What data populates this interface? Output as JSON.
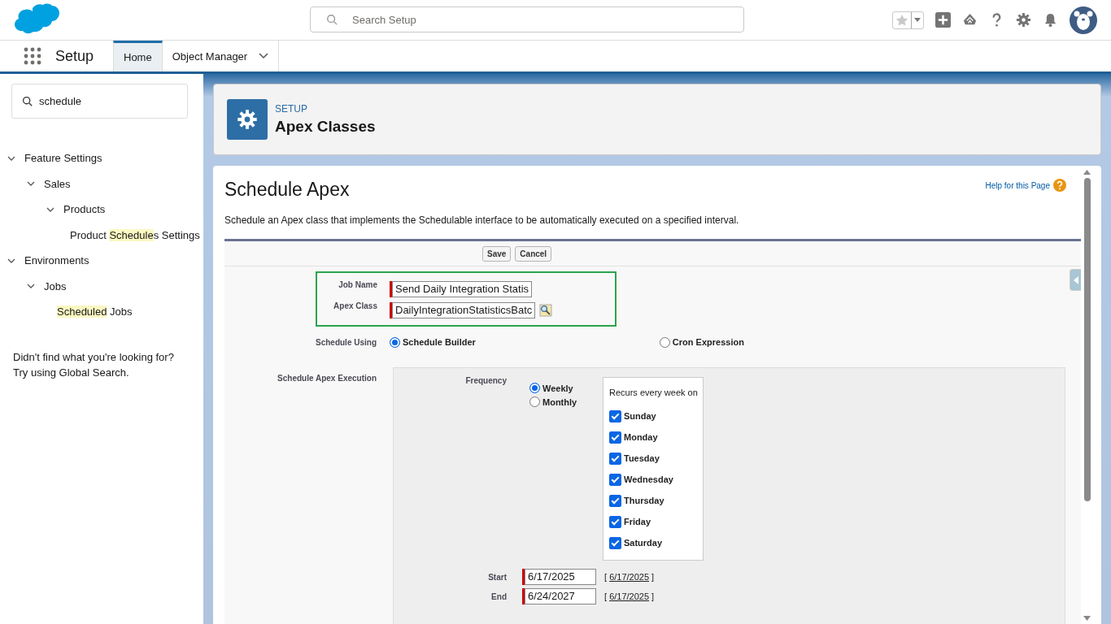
{
  "header": {
    "search": {
      "placeholder": "Search Setup"
    }
  },
  "nav": {
    "app_name": "Setup",
    "tabs": [
      {
        "label": "Home",
        "selected": true,
        "dropdown": false
      },
      {
        "label": "Object Manager",
        "selected": false,
        "dropdown": true
      }
    ]
  },
  "sidebar": {
    "search": {
      "value": "schedule"
    },
    "tree": [
      {
        "parts": [
          {
            "text": "Feature Settings",
            "highlighted": false
          }
        ],
        "expanded": true,
        "children": [
          {
            "parts": [
              {
                "text": "Sales",
                "highlighted": false
              }
            ],
            "expanded": true,
            "children": [
              {
                "parts": [
                  {
                    "text": "Products",
                    "highlighted": false
                  }
                ],
                "expanded": true,
                "children": [
                  {
                    "parts": [
                      {
                        "text": "Product ",
                        "highlighted": false
                      },
                      {
                        "text": "Schedule",
                        "highlighted": true
                      },
                      {
                        "text": "s Settings",
                        "highlighted": false
                      }
                    ]
                  }
                ]
              }
            ]
          }
        ]
      },
      {
        "parts": [
          {
            "text": "Environments",
            "highlighted": false
          }
        ],
        "expanded": true,
        "children": [
          {
            "parts": [
              {
                "text": "Jobs",
                "highlighted": false
              }
            ],
            "expanded": true,
            "children": [
              {
                "parts": [
                  {
                    "text": "Scheduled",
                    "highlighted": true
                  },
                  {
                    "text": " Jobs",
                    "highlighted": false
                  }
                ]
              }
            ]
          }
        ]
      }
    ],
    "note_lines": [
      "Didn't find what you're looking for?",
      "Try using Global Search."
    ]
  },
  "page_header": {
    "eyebrow": "SETUP",
    "title": "Apex Classes"
  },
  "main": {
    "title": "Schedule Apex",
    "help_link": "Help for this Page",
    "description": "Schedule an Apex class that implements the Schedulable interface to be automatically executed on a specified interval.",
    "buttons": [
      "Save",
      "Cancel"
    ],
    "job_name": {
      "label": "Job Name",
      "value": "Send Daily Integration Statis"
    },
    "apex_class": {
      "label": "Apex Class",
      "value": "DailyIntegrationStatisticsBatc"
    },
    "schedule_using": {
      "label": "Schedule Using",
      "options": [
        {
          "label": "Schedule Builder",
          "selected": true
        },
        {
          "label": "Cron Expression",
          "selected": false
        }
      ]
    },
    "execution": {
      "label": "Schedule Apex Execution",
      "frequency_label": "Frequency",
      "frequency": [
        {
          "label": "Weekly",
          "selected": true
        },
        {
          "label": "Monthly",
          "selected": false
        }
      ],
      "recurs_title": "Recurs every week on",
      "days": [
        {
          "label": "Sunday",
          "checked": true
        },
        {
          "label": "Monday",
          "checked": true
        },
        {
          "label": "Tuesday",
          "checked": true
        },
        {
          "label": "Wednesday",
          "checked": true
        },
        {
          "label": "Thursday",
          "checked": true
        },
        {
          "label": "Friday",
          "checked": true
        },
        {
          "label": "Saturday",
          "checked": true
        }
      ],
      "dates": [
        {
          "label": "Start",
          "value": "6/17/2025",
          "open": "[",
          "link": "6/17/2025",
          "close": "]"
        },
        {
          "label": "End",
          "value": "6/24/2027",
          "open": "[",
          "link": "6/17/2025",
          "close": "]"
        }
      ]
    }
  }
}
